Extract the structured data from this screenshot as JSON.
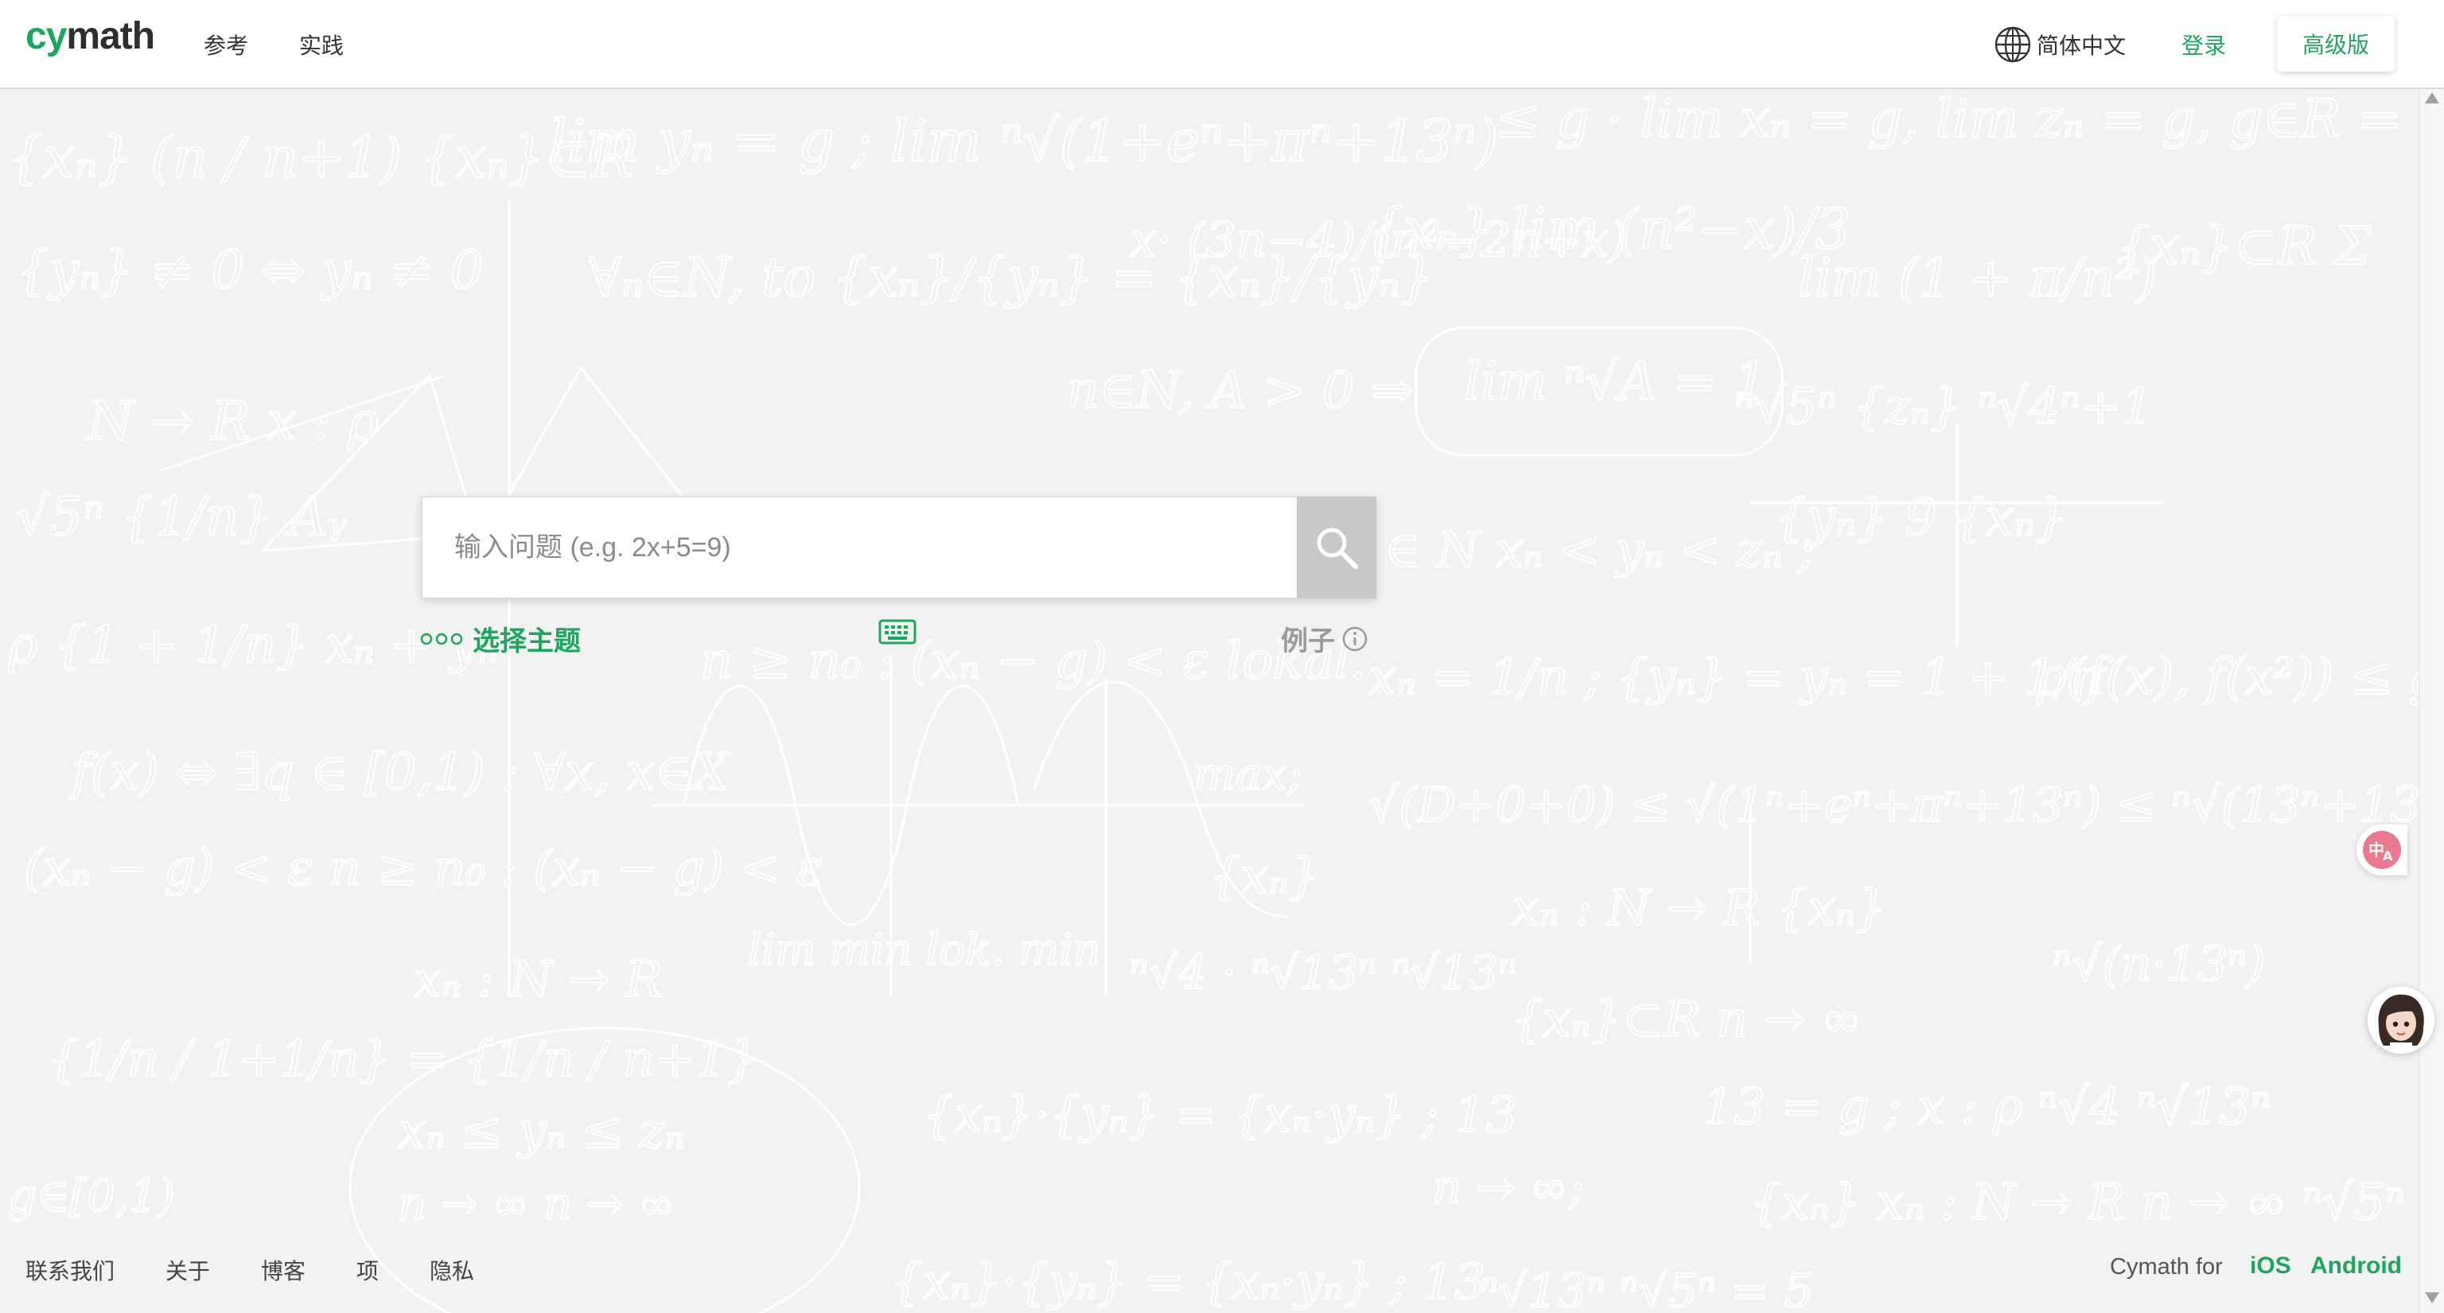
{
  "header": {
    "logo_cy": "cy",
    "logo_math": "math",
    "nav": [
      "参考",
      "实践"
    ],
    "language": "简体中文",
    "login": "登录",
    "premium": "高级版"
  },
  "search": {
    "placeholder": "输入问题 (e.g. 2x+5=9)",
    "value": ""
  },
  "tools": {
    "topic": "选择主题",
    "examples": "例子"
  },
  "footer": {
    "links": [
      "联系我们",
      "关于",
      "博客",
      "项",
      "隐私"
    ],
    "apps_prefix": "Cymath for",
    "ios": "iOS",
    "android": "Android"
  },
  "colors": {
    "accent": "#1fa55f",
    "background": "#f2f2f2",
    "search_button": "#c8c8c8"
  },
  "icons": {
    "language": "globe-icon",
    "search": "magnifier-icon",
    "topic": "dots-icon",
    "keyboard": "keyboard-icon",
    "examples": "info-icon",
    "translate": "translate-icon",
    "assistant": "avatar-icon"
  }
}
